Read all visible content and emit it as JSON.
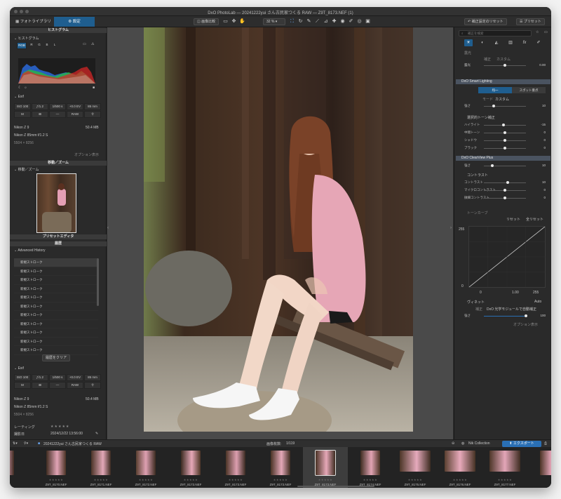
{
  "window": {
    "title": "DxO PhotoLab — 20241222yui さん古民家つくる RAW — Z9T_8173.NEF (1)"
  },
  "toolbar": {
    "tab_library": "フォトライブラリ",
    "tab_customize": "設定",
    "compare_label": "画像比較",
    "zoom_value": "32 %",
    "reset_label": "補正設定のリセット",
    "preset_label": "プリセット"
  },
  "left": {
    "histogram_title": "ヒストグラム",
    "histogram_sub": "ヒストグラム",
    "channels": [
      "RGB",
      "R",
      "G",
      "B",
      "L"
    ],
    "exif_label": "Exif",
    "exif_top": [
      "ISO 100",
      "ƒ/1.2",
      "1/500 s",
      "+0.0 EV",
      "85 mm",
      "M",
      "⊞",
      "—",
      "RAW",
      "⚲"
    ],
    "camera": "Nikon Z 9",
    "size": "50.4 MB",
    "lens": "Nikon Z 85mm f/1.2 S",
    "dimensions": "5504 × 8256",
    "option_display": "オプション表示",
    "navigator_title": "移動／ズーム",
    "navigator_sub": "移動／ズーム",
    "preset_editor_title": "プリセットエディタ",
    "history_title": "履歴",
    "history_sub": "Advanced History",
    "history_items": [
      "新規ストローク",
      "新規ストローク",
      "新規ストローク",
      "新規ストローク",
      "新規ストローク",
      "新規ストローク",
      "新規ストローク",
      "新規ストローク",
      "新規ストローク",
      "新規ストローク",
      "新規ストローク"
    ],
    "clear_history": "履歴をクリア",
    "exif2_label": "Exif",
    "rating_label": "レーティング",
    "shot_label": "撮影日",
    "shot_value": "2024/12/22 13:56:00"
  },
  "right": {
    "search_placeholder": "補正を検索",
    "light_section": "露光",
    "light_correction": "補正",
    "light_mode": "カスタム",
    "light_amount_label": "露光",
    "light_amount_value": "0.00",
    "smart_lighting": "DxO Smart Lighting",
    "btn_uniform": "均一",
    "btn_spot": "スポット重点",
    "mode_label": "モード",
    "mode_value": "カスタム",
    "intensity_label": "強さ",
    "intensity_value": "10",
    "tone_section": "選択的トーン補正",
    "tone_rows": [
      {
        "name": "ハイライト",
        "value": "-15"
      },
      {
        "name": "中間トーン",
        "value": "0"
      },
      {
        "name": "シャドウ",
        "value": "0"
      },
      {
        "name": "ブラック",
        "value": "0"
      }
    ],
    "clearview": "DxO ClearView Plus",
    "clearview_label": "強さ",
    "clearview_value": "10",
    "contrast_section": "コントラスト",
    "contrast_rows": [
      {
        "name": "コントラスト",
        "value": "10"
      },
      {
        "name": "マイクロコントラスト",
        "value": "0"
      },
      {
        "name": "微細コントラスト",
        "value": "0"
      }
    ],
    "tonecurve": "トーンカーブ",
    "tc_reset": "リセット",
    "tc_reset_all": "全リセット",
    "tc_top": "255",
    "tc_zero": "0",
    "tc_bottom": [
      "0",
      "1.00",
      "255"
    ],
    "vignette": "ヴィネット",
    "vignette_auto": "Auto",
    "vignette_correction": "補正",
    "vignette_module": "DxO 光学モジュールで自動補正",
    "vignette_strength_label": "強さ",
    "vignette_strength_value": "100",
    "option_display": "オプション表示"
  },
  "filmbar": {
    "folder": "20241222yui さん古民家つくる RAW",
    "count_label": "画像枚数:",
    "count_value": "1/119",
    "nik": "Nik Collection",
    "export": "エクスポート"
  },
  "thumbs": [
    "Z9T_8170.NEF",
    "Z9T_8171.NEF",
    "Z9T_8172.NEF",
    "Z9T_8173.NEF",
    "Z9T_8174.NEF",
    "Z9T_8175.NEF",
    "Z9T_8176.NEF",
    "Z9T_8177.NEF"
  ],
  "colors": {
    "accent": "#1f5e8f",
    "export": "#2a6fb4"
  }
}
